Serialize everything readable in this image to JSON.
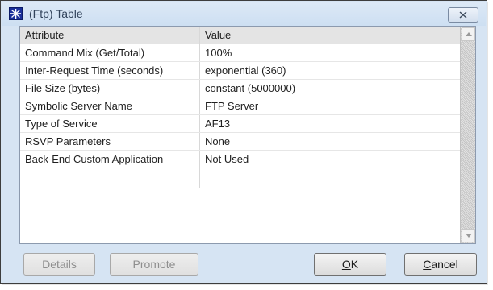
{
  "window": {
    "title": "(Ftp) Table",
    "icon": "app-star-icon",
    "close_icon": "close-icon"
  },
  "table": {
    "headers": {
      "attribute": "Attribute",
      "value": "Value"
    },
    "rows": [
      {
        "attribute": "Command Mix (Get/Total)",
        "value": "100%"
      },
      {
        "attribute": "Inter-Request Time (seconds)",
        "value": "exponential (360)"
      },
      {
        "attribute": "File Size (bytes)",
        "value": "constant (5000000)"
      },
      {
        "attribute": "Symbolic Server Name",
        "value": "FTP Server"
      },
      {
        "attribute": "Type of Service",
        "value": "AF13"
      },
      {
        "attribute": "RSVP Parameters",
        "value": "None"
      },
      {
        "attribute": "Back-End Custom Application",
        "value": "Not Used"
      }
    ]
  },
  "buttons": {
    "details": {
      "label": "Details",
      "enabled": false
    },
    "promote": {
      "label": "Promote",
      "enabled": false
    },
    "ok": {
      "first": "O",
      "rest": "K",
      "enabled": true
    },
    "cancel": {
      "first": "C",
      "rest": "ancel",
      "enabled": true
    }
  }
}
